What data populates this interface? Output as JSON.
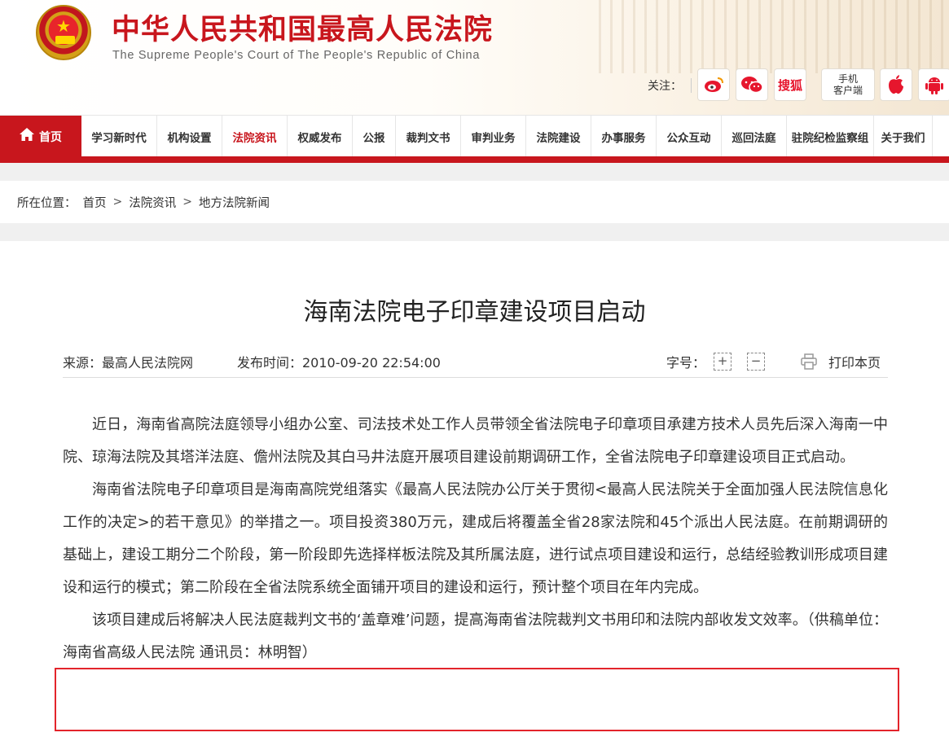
{
  "header": {
    "title": "中华人民共和国最高人民法院",
    "subtitle": "The Supreme People's Court of The People's Republic of China",
    "follow_label": "关注：",
    "follow_icons": [
      "weibo-icon",
      "wechat-icon",
      "sohu-icon",
      "mobile-client-icon",
      "apple-icon",
      "android-icon"
    ],
    "sohu_label": "搜狐",
    "mobile_label_1": "手机",
    "mobile_label_2": "客户端"
  },
  "nav": {
    "home": "首页",
    "items": [
      "学习新时代",
      "机构设置",
      "法院资讯",
      "权威发布",
      "公报",
      "裁判文书",
      "审判业务",
      "法院建设",
      "办事服务",
      "公众互动",
      "巡回法庭",
      "驻院纪检监察组",
      "关于我们"
    ],
    "active_index": 2,
    "accent_color": "#c8161d"
  },
  "breadcrumb": {
    "label": "所在位置：",
    "items": [
      "首页",
      "法院资讯",
      "地方法院新闻"
    ],
    "separator": ">"
  },
  "article": {
    "title": "海南法院电子印章建设项目启动",
    "source": "来源：最高人民法院网",
    "pubtime": "发布时间：2010-09-20 22:54:00",
    "fontsize_label": "字号：",
    "fontsize_plus": "+",
    "fontsize_minus": "−",
    "print_label": "打印本页",
    "paragraphs": [
      "近日，海南省高院法庭领导小组办公室、司法技术处工作人员带领全省法院电子印章项目承建方技术人员先后深入海南一中院、琼海法院及其塔洋法庭、儋州法院及其白马井法庭开展项目建设前期调研工作，全省法院电子印章建设项目正式启动。",
      "海南省法院电子印章项目是海南高院党组落实《最高人民法院办公厅关于贯彻<最高人民法院关于全面加强人民法院信息化工作的决定>的若干意见》的举措之一。项目投资380万元，建成后将覆盖全省28家法院和45个派出人民法庭。在前期调研的基础上，建设工期分二个阶段，第一阶段即先选择样板法院及其所属法庭，进行试点项目建设和运行，总结经验教训形成项目建设和运行的模式；第二阶段在全省法院系统全面铺开项目的建设和运行，预计整个项目在年内完成。",
      "该项目建成后将解决人民法庭裁判文书的‘盖章难’问题，提高海南省法院裁判文书用印和法院内部收发文效率。（供稿单位：海南省高级人民法院 通讯员：林明智）"
    ],
    "highlight_color": "#e3242b"
  }
}
